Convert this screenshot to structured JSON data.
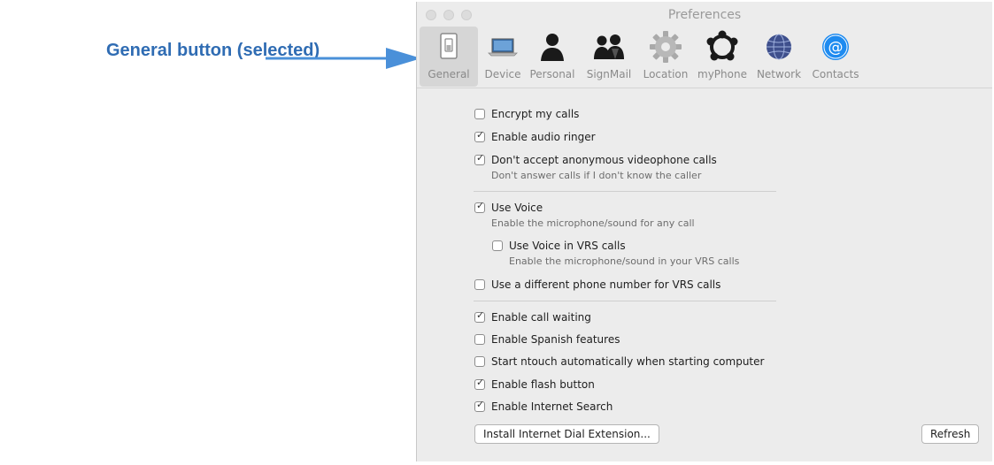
{
  "callout": {
    "text": "General button (selected)"
  },
  "window": {
    "title": "Preferences"
  },
  "toolbar": {
    "items": [
      {
        "label": "General",
        "icon": "switch-icon",
        "selected": true
      },
      {
        "label": "Device",
        "icon": "laptop-icon",
        "selected": false
      },
      {
        "label": "Personal",
        "icon": "person-icon",
        "selected": false
      },
      {
        "label": "SignMail",
        "icon": "people-icon",
        "selected": false
      },
      {
        "label": "Location",
        "icon": "gear-icon",
        "selected": false
      },
      {
        "label": "myPhone",
        "icon": "ring-icon",
        "selected": false
      },
      {
        "label": "Network",
        "icon": "globe-icon",
        "selected": false
      },
      {
        "label": "Contacts",
        "icon": "at-icon",
        "selected": false
      }
    ]
  },
  "options": {
    "encrypt": {
      "label": "Encrypt my calls",
      "checked": false
    },
    "audio_ringer": {
      "label": "Enable audio ringer",
      "checked": true
    },
    "anonymous": {
      "label": "Don't accept anonymous videophone calls",
      "sub": "Don't answer calls if I don't know the caller",
      "checked": true
    },
    "use_voice": {
      "label": "Use Voice",
      "sub": "Enable the microphone/sound for any call",
      "checked": true
    },
    "voice_vrs": {
      "label": "Use Voice in VRS calls",
      "sub": "Enable the microphone/sound in your VRS calls",
      "checked": false
    },
    "diff_number": {
      "label": "Use a different phone number for VRS calls",
      "checked": false
    },
    "call_waiting": {
      "label": "Enable call waiting",
      "checked": true
    },
    "spanish": {
      "label": "Enable Spanish features",
      "checked": false
    },
    "autostart": {
      "label": "Start ntouch automatically when starting computer",
      "checked": false
    },
    "flash": {
      "label": "Enable flash button",
      "checked": true
    },
    "internet_search": {
      "label": "Enable Internet Search",
      "checked": true
    }
  },
  "buttons": {
    "install": "Install Internet Dial Extension...",
    "refresh": "Refresh"
  },
  "colors": {
    "callout": "#2f6cb3",
    "window_bg": "#ececec",
    "contacts_icon": "#1e8bf0"
  }
}
